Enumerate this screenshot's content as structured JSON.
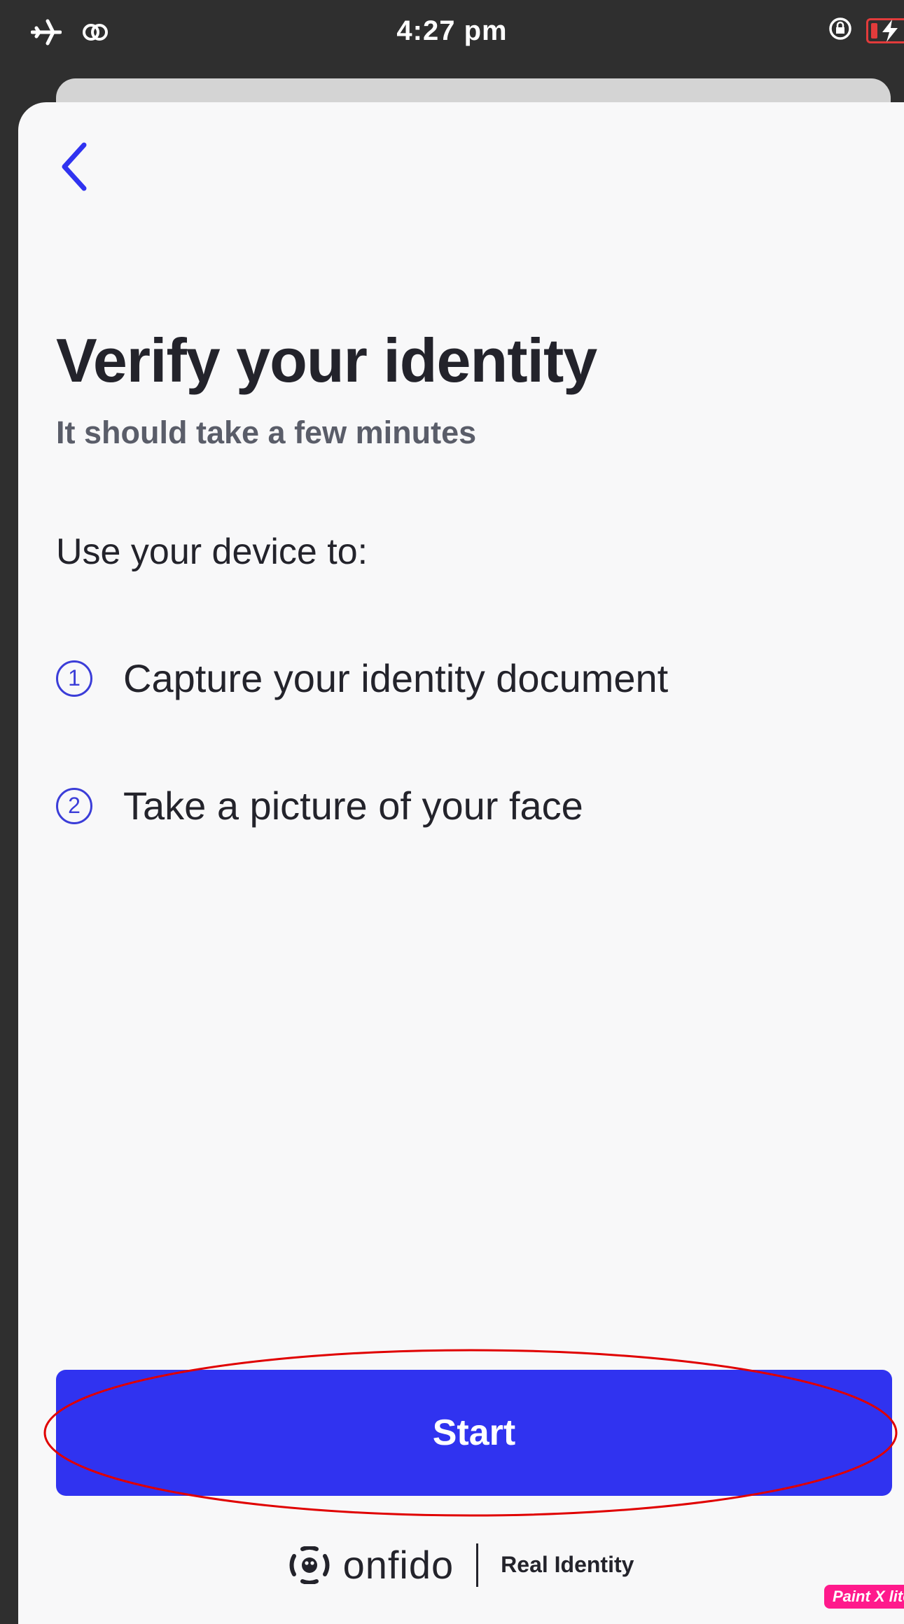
{
  "status_bar": {
    "time": "4:27 pm",
    "left_icons": [
      "airplane-icon",
      "link-icon"
    ],
    "right_icons": [
      "rotation-lock-icon",
      "battery-charging-icon"
    ],
    "battery_level": 0.1,
    "battery_color": "#e23b3b"
  },
  "nav": {
    "back_icon": "chevron-left-icon"
  },
  "content": {
    "title": "Verify your identity",
    "subtitle": "It should take a few minutes",
    "lead": "Use your device to:",
    "steps": [
      {
        "number": "1",
        "text": "Capture your identity document"
      },
      {
        "number": "2",
        "text": "Take a picture of your face"
      }
    ]
  },
  "actions": {
    "start_label": "Start"
  },
  "branding": {
    "name": "onfido",
    "tagline": "Real Identity"
  },
  "watermark": {
    "text": "Paint X lite"
  },
  "colors": {
    "accent": "#3033f0",
    "title": "#23232b",
    "subtitle": "#5a5d69",
    "background": "#f8f8f9",
    "annotation": "#e00000"
  }
}
